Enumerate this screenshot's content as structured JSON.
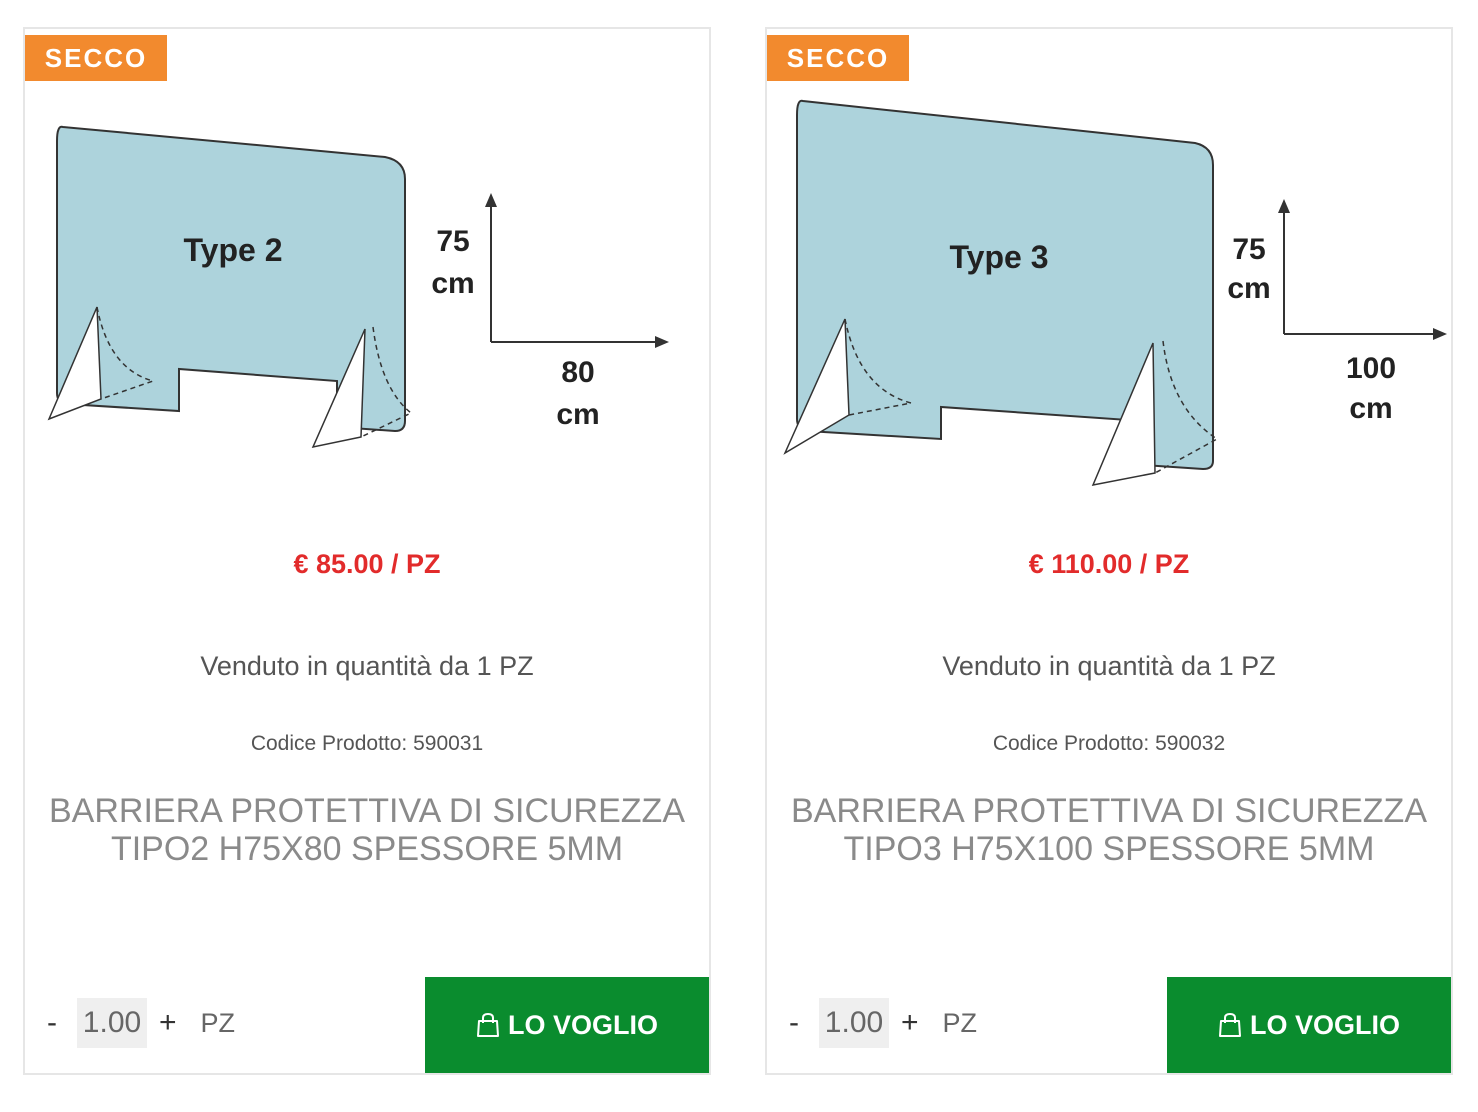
{
  "products": [
    {
      "badge": "SECCO",
      "image": {
        "type_label": "Type 2",
        "height_value": "75",
        "height_unit": "cm",
        "width_value": "80",
        "width_unit": "cm"
      },
      "price": "€ 85.00 / PZ",
      "sold_in": "Venduto in quantità da 1 PZ",
      "code": "Codice Prodotto: 590031",
      "title": "BARRIERA PROTETTIVA DI SICUREZZA TIPO2 H75X80 SPESSORE 5MM",
      "quantity": {
        "minus": "-",
        "value": "1.00",
        "plus": "+",
        "unit": "PZ"
      },
      "buy_label": "LO VOGLIO"
    },
    {
      "badge": "SECCO",
      "image": {
        "type_label": "Type 3",
        "height_value": "75",
        "height_unit": "cm",
        "width_value": "100",
        "width_unit": "cm"
      },
      "price": "€ 110.00 / PZ",
      "sold_in": "Venduto in quantità da 1 PZ",
      "code": "Codice Prodotto: 590032",
      "title": "BARRIERA PROTETTIVA DI SICUREZZA TIPO3 H75X100 SPESSORE 5MM",
      "quantity": {
        "minus": "-",
        "value": "1.00",
        "plus": "+",
        "unit": "PZ"
      },
      "buy_label": "LO VOGLIO"
    }
  ],
  "colors": {
    "badge": "#f28a2e",
    "price": "#e22b2b",
    "buy_button": "#0a8c2e",
    "panel": "#add3dc"
  },
  "icons": {
    "buy": "shopping-bag-icon"
  }
}
